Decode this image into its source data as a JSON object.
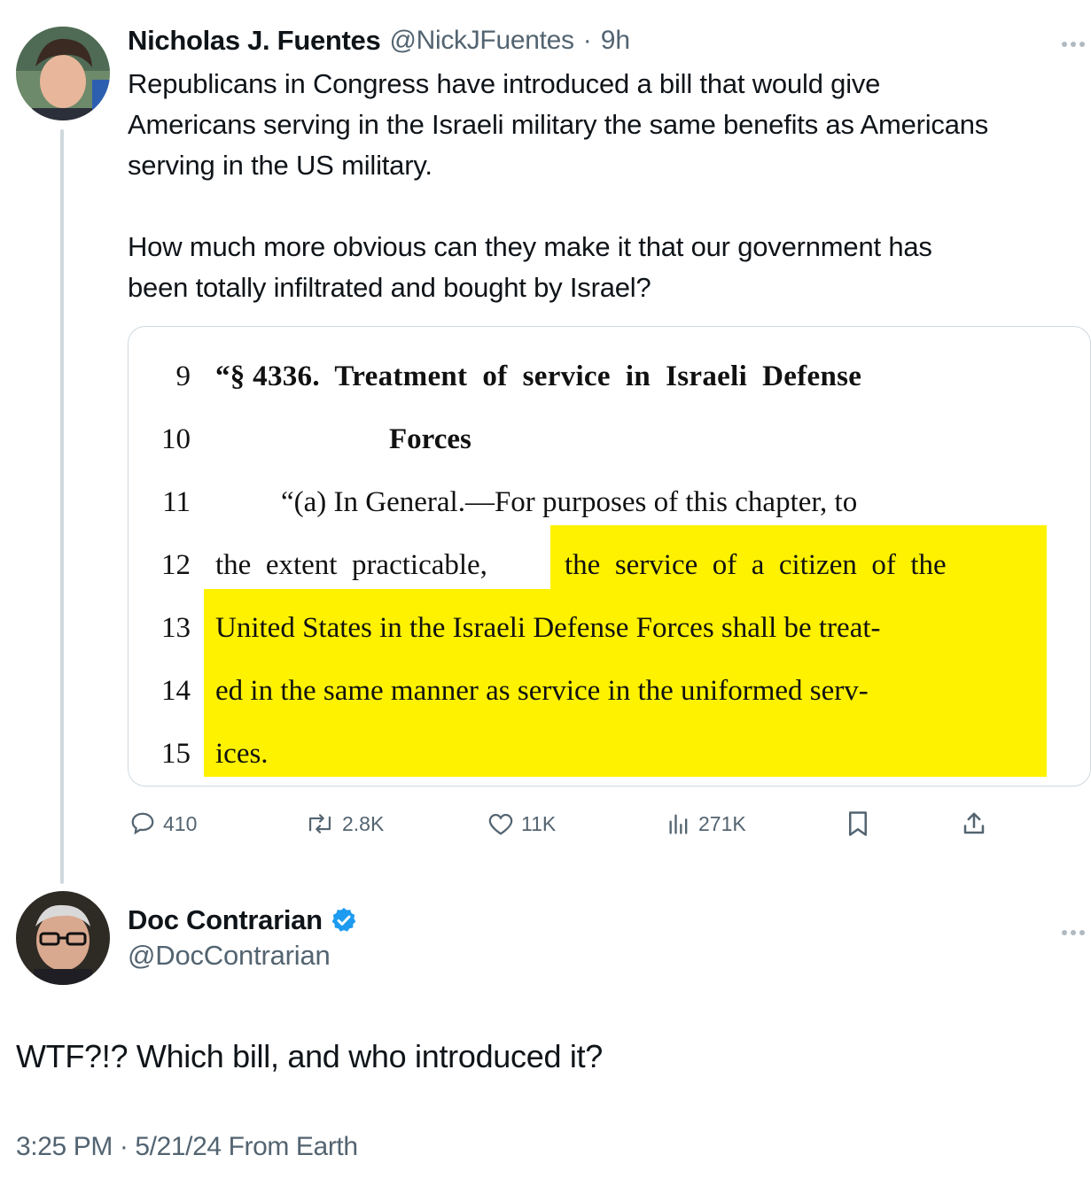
{
  "original_tweet": {
    "author_name": "Nicholas J. Fuentes",
    "handle": "@NickJFuentes",
    "separator": "·",
    "time": "9h",
    "text": "Republicans in Congress have introduced a bill that would give\nAmericans serving in the Israeli military the same benefits as Americans\nserving in the US military.\n\nHow much more obvious can they make it that our government has\nbeen totally infiltrated and bought by Israel?",
    "more_icon": "more-horizontal-icon",
    "attached_document": {
      "lines": [
        {
          "number": "9",
          "text": "“§ 4336.  Treatment  of  service  in  Israeli  Defense"
        },
        {
          "number": "10",
          "text": "Forces"
        },
        {
          "number": "11",
          "text": "“(a) In General.—For purposes of this chapter, to"
        },
        {
          "number": "12",
          "text": "the  extent  practicable,",
          "highlighted": "the  service  of  a  citizen  of  the"
        },
        {
          "number": "13",
          "text": "United States in the Israeli Defense Forces shall be treat-"
        },
        {
          "number": "14",
          "text": "ed in the same manner as service in the uniformed serv-"
        },
        {
          "number": "15",
          "text": "ices."
        }
      ],
      "highlight_color": "#fff200"
    },
    "actions": {
      "replies": "410",
      "reposts": "2.8K",
      "likes": "11K",
      "views": "271K"
    }
  },
  "reply_tweet": {
    "author_name": "Doc Contrarian",
    "verified": true,
    "handle": "@DocContrarian",
    "text": "WTF?!? Which bill, and who introduced it?",
    "timestamp": "3:25 PM · 5/21/24 From Earth",
    "more_icon": "more-horizontal-icon"
  },
  "colors": {
    "text": "#0f1419",
    "muted": "#536471",
    "verified": "#1d9bf0",
    "border": "#cfd9de"
  }
}
